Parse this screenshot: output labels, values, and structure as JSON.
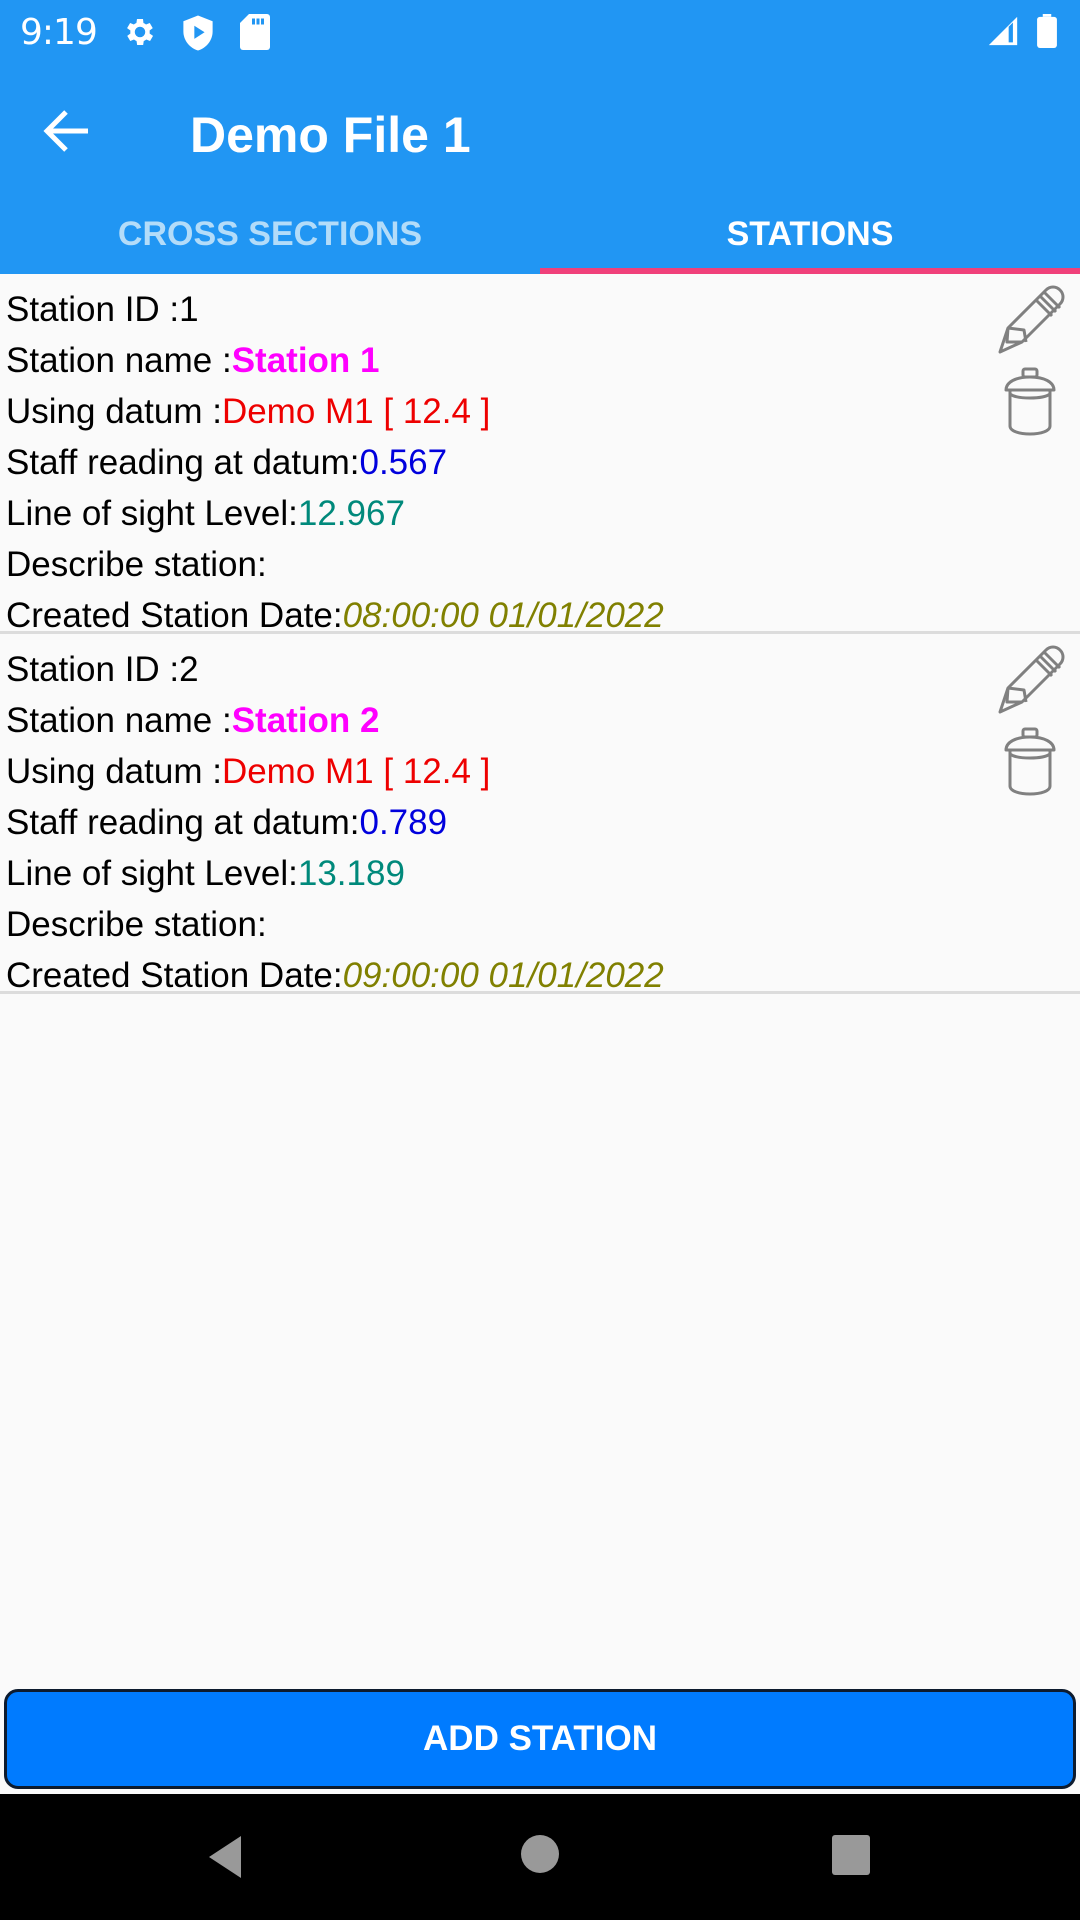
{
  "status_bar": {
    "time": "9:19",
    "left_icons": [
      "gear-icon",
      "shield-play-icon",
      "sd-card-icon"
    ],
    "right_icons": [
      "signal-icon",
      "battery-icon"
    ]
  },
  "app_bar": {
    "title": "Demo File 1",
    "back_icon": "arrow-left-icon"
  },
  "tabs": [
    {
      "label": "CROSS SECTIONS",
      "active": false
    },
    {
      "label": "STATIONS",
      "active": true
    }
  ],
  "stations": [
    {
      "id_label": "Station ID :",
      "id": "1",
      "name_label": "Station name :",
      "name": "Station 1",
      "datum_label": "Using datum :",
      "datum": "Demo M1 [ 12.4 ]",
      "staff_label": "Staff reading at datum:",
      "staff": "0.567",
      "los_label": "Line of sight Level:",
      "los": "12.967",
      "describe_label": "Describe station:",
      "describe": "",
      "date_label": "Created Station Date:",
      "date": "08:00:00 01/01/2022"
    },
    {
      "id_label": "Station ID :",
      "id": "2",
      "name_label": "Station name :",
      "name": "Station 2",
      "datum_label": "Using datum :",
      "datum": "Demo M1 [ 12.4 ]",
      "staff_label": "Staff reading at datum:",
      "staff": "0.789",
      "los_label": "Line of sight Level:",
      "los": "13.189",
      "describe_label": "Describe station:",
      "describe": "",
      "date_label": "Created Station Date:",
      "date": "09:00:00 01/01/2022"
    }
  ],
  "actions": {
    "add_station_label": "ADD STATION"
  },
  "colors": {
    "primary": "#2196f3",
    "tab_indicator": "#f0407a",
    "button": "#007bff",
    "station_name": "#ff00ff",
    "datum": "#ee0000",
    "staff_reading": "#0000dd",
    "line_of_sight": "#00897b",
    "date": "#808000"
  }
}
